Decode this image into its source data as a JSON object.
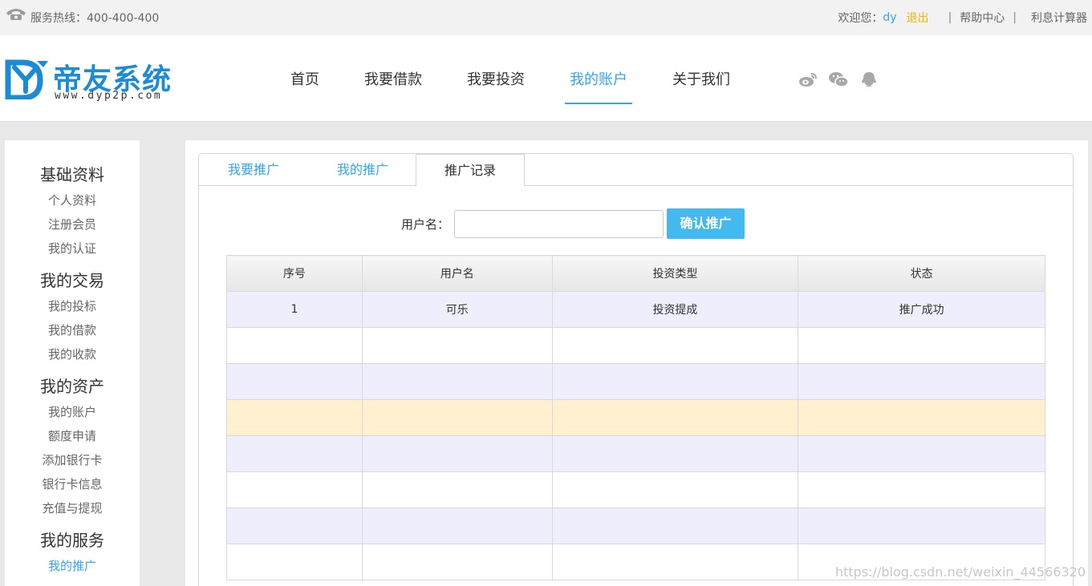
{
  "topbar": {
    "hotline": "服务热线：400-400-400",
    "welcome": "欢迎您：",
    "username": "dy",
    "logout": "退出",
    "sep": "|",
    "help": "帮助中心",
    "calculator": "利息计算器"
  },
  "header": {
    "logo_text": "帝友系统",
    "logo_url": "www.dyp2p.com",
    "nav": [
      {
        "label": "首页"
      },
      {
        "label": "我要借款"
      },
      {
        "label": "我要投资"
      },
      {
        "label": "我的账户"
      },
      {
        "label": "关于我们"
      }
    ],
    "social": [
      "weibo-icon",
      "wechat-icon",
      "qq-icon"
    ]
  },
  "sidebar": {
    "groups": [
      {
        "title": "基础资料",
        "items": [
          "个人资料",
          "注册会员",
          "我的认证"
        ]
      },
      {
        "title": "我的交易",
        "items": [
          "我的投标",
          "我的借款",
          "我的收款"
        ]
      },
      {
        "title": "我的资产",
        "items": [
          "我的账户",
          "额度申请",
          "添加银行卡",
          "银行卡信息",
          "充值与提现"
        ]
      },
      {
        "title": "我的服务",
        "items": [
          "我的推广"
        ]
      }
    ]
  },
  "tabs": {
    "t1": "我要推广",
    "t2": "我的推广",
    "t3": "推广记录"
  },
  "form": {
    "label": "用户名：",
    "value": "",
    "button": "确认推广"
  },
  "table": {
    "headers": [
      "序号",
      "用户名",
      "投资类型",
      "状态"
    ],
    "rows": [
      [
        "1",
        "可乐",
        "投资提成",
        "推广成功"
      ]
    ]
  },
  "watermark": "https://blog.csdn.net/weixin_44566320",
  "colors": {
    "accent": "#2fa7e8",
    "logout": "#f2b500",
    "button": "#44b9f0",
    "row_lavender": "#eeeefc",
    "row_highlight": "#fff1d0"
  }
}
